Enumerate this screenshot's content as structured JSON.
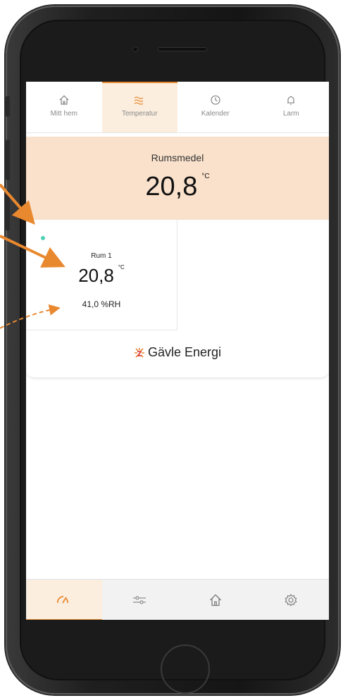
{
  "top_tabs": [
    {
      "label": "Mitt hem",
      "icon": "home-icon"
    },
    {
      "label": "Temperatur",
      "icon": "heat-waves-icon",
      "active": true
    },
    {
      "label": "Kalender",
      "icon": "clock-icon"
    },
    {
      "label": "Larm",
      "icon": "bell-icon"
    }
  ],
  "summary": {
    "label": "Rumsmedel",
    "value": "20,8",
    "unit": "°C"
  },
  "room": {
    "name": "Rum 1",
    "temperature": "20,8",
    "unit": "°C",
    "humidity": "41,0 %RH",
    "status_color": "#4fd1b5"
  },
  "brand": {
    "name": "Gävle Energi"
  },
  "bottom_tabs": [
    {
      "icon": "gauge-icon",
      "active": true
    },
    {
      "icon": "sliders-icon"
    },
    {
      "icon": "home-icon"
    },
    {
      "icon": "gear-icon"
    }
  ],
  "colors": {
    "accent": "#e9892f",
    "summary_bg": "#f9e1cb",
    "active_tab_bg": "#fbeedf"
  }
}
